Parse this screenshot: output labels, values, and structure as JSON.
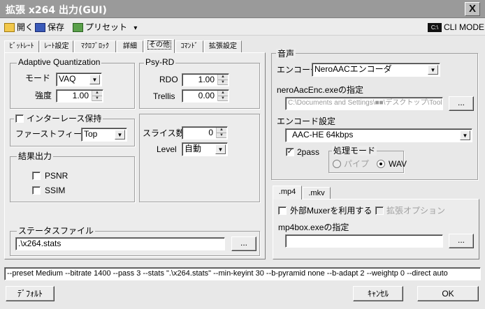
{
  "window": {
    "title": "拡張 x264 出力(GUI)",
    "close": "X"
  },
  "toolbar": {
    "open": "開く",
    "save": "保存",
    "preset": "プリセット",
    "preset_arrow": "▾",
    "cli_icon": "C:\\",
    "cli_mode": "CLI MODE"
  },
  "tabs": [
    "ﾋﾞｯﾄﾚｰﾄ",
    "ﾚｰﾄ設定",
    "ﾏｸﾛﾌﾞﾛｯｸ",
    "詳細",
    "その他",
    "ｺﾏﾝﾄﾞ",
    "拡張設定"
  ],
  "aq": {
    "title": "Adaptive Quantization",
    "mode_label": "モード",
    "mode_value": "VAQ",
    "strength_label": "強度",
    "strength_value": "1.00"
  },
  "psyrd": {
    "title": "Psy-RD",
    "rdo_label": "RDO",
    "rdo_value": "1.00",
    "trellis_label": "Trellis",
    "trellis_value": "0.00"
  },
  "interlace": {
    "label": "インターレース保持",
    "first_field_label": "ファーストフィールド",
    "first_field_value": "Top"
  },
  "slice": {
    "count_label": "スライス数",
    "count_value": "0",
    "level_label": "Level",
    "level_value": "自動"
  },
  "results": {
    "title": "結果出力",
    "psnr": "PSNR",
    "ssim": "SSIM"
  },
  "status": {
    "title": "ステータスファイル",
    "value": ".\\x264.stats",
    "browse": "..."
  },
  "audio": {
    "title": "音声",
    "encoder_label": "エンコーダ",
    "encoder_value": "NeroAACエンコーダ",
    "exe_label": "neroAacEnc.exeの指定",
    "exe_value": "C:\\Documents and Settings\\■■\\デスクトップ\\Tools",
    "browse": "...",
    "encode_settings_label": "エンコード設定",
    "encode_settings_value": "AAC-HE 64kbps",
    "twopass_label": "2pass",
    "twopass_check": "✓",
    "process_mode_title": "処理モード",
    "pipe": "パイプ",
    "wav": "WAV"
  },
  "mux": {
    "tabs": [
      ".mp4",
      ".mkv"
    ],
    "external_muxer": "外部Muxerを利用する",
    "ext_option": "拡張オプション",
    "exe_label": "mp4box.exeの指定",
    "browse": "..."
  },
  "command_line": "--preset Medium --bitrate 1400 --pass 3 --stats \".\\x264.stats\" --min-keyint 30 --b-pyramid none --b-adapt 2 --weightp 0 --direct auto",
  "buttons": {
    "default": "ﾃﾞﾌｫﾙﾄ",
    "cancel": "ｷｬﾝｾﾙ",
    "ok": "OK"
  },
  "icons": {
    "open": "folder-icon",
    "save": "floppy-icon",
    "preset": "preset-icon",
    "cli": "console-icon"
  }
}
